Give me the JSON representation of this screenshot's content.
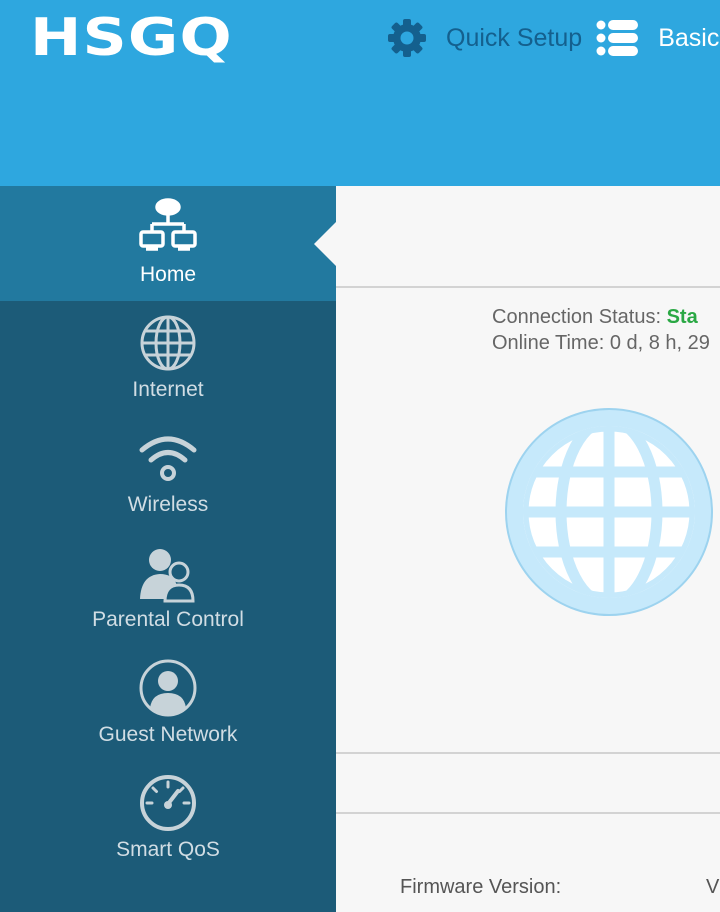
{
  "header": {
    "logo": "HSGQ",
    "nav": [
      {
        "label": "Quick Setup",
        "icon": "gear-icon"
      },
      {
        "label": "Basic",
        "icon": "list-icon"
      }
    ]
  },
  "sidebar": {
    "items": [
      {
        "label": "Home",
        "icon": "network-topology-icon",
        "active": true
      },
      {
        "label": "Internet",
        "icon": "globe-icon"
      },
      {
        "label": "Wireless",
        "icon": "wifi-icon"
      },
      {
        "label": "Parental Control",
        "icon": "users-icon"
      },
      {
        "label": "Guest Network",
        "icon": "guest-user-icon"
      },
      {
        "label": "Smart QoS",
        "icon": "speedometer-icon"
      }
    ]
  },
  "main": {
    "connection_status_label": "Connection Status:",
    "connection_status_value": "Sta",
    "online_time_label": "Online Time:",
    "online_time_value": "0 d, 8 h, 29",
    "globe_icon": "globe-icon",
    "firmware_label": "Firmware Version:",
    "firmware_value": "V"
  },
  "colors": {
    "header_bg": "#2ea7df",
    "sidebar_bg": "#1c5b78",
    "sidebar_active_bg": "#22799f",
    "status_ok": "#2aa844",
    "globe_fill": "#c6e9fb"
  }
}
